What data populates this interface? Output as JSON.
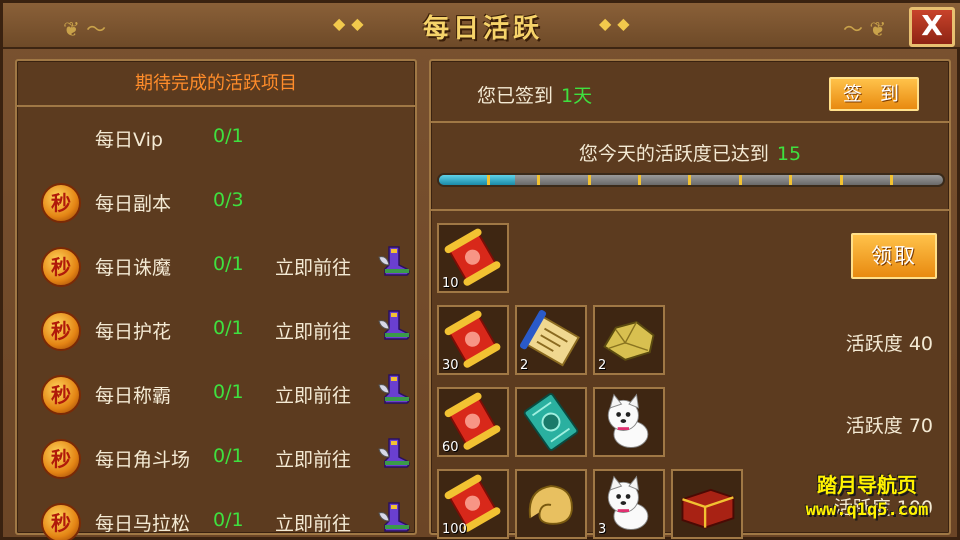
{
  "window": {
    "title": "每日活跃",
    "close_label": "X"
  },
  "left": {
    "header": "期待完成的活跃项目",
    "badge_text": "秒",
    "tasks": [
      {
        "name": "每日Vip",
        "progress": "0/1",
        "badge": false,
        "go": ""
      },
      {
        "name": "每日副本",
        "progress": "0/3",
        "badge": true,
        "go": ""
      },
      {
        "name": "每日诛魔",
        "progress": "0/1",
        "badge": true,
        "go": "立即前往"
      },
      {
        "name": "每日护花",
        "progress": "0/1",
        "badge": true,
        "go": "立即前往"
      },
      {
        "name": "每日称霸",
        "progress": "0/1",
        "badge": true,
        "go": "立即前往"
      },
      {
        "name": "每日角斗场",
        "progress": "0/1",
        "badge": true,
        "go": "立即前往"
      },
      {
        "name": "每日马拉松",
        "progress": "0/1",
        "badge": true,
        "go": "立即前往"
      }
    ]
  },
  "right": {
    "sign": {
      "prefix": "您已签到",
      "days": "1天",
      "button": "签 到"
    },
    "activity": {
      "prefix": "您今天的活跃度已达到",
      "value": "15",
      "fill_fraction": 0.15,
      "ticks": 10
    },
    "claim_button": "领取",
    "rewards": [
      {
        "requirement": "",
        "items": [
          {
            "icon": "red-scroll",
            "count": "10"
          }
        ]
      },
      {
        "requirement": "活跃度 40",
        "items": [
          {
            "icon": "red-scroll",
            "count": "30"
          },
          {
            "icon": "blue-scroll",
            "count": "2"
          },
          {
            "icon": "gold-ore",
            "count": "2"
          }
        ]
      },
      {
        "requirement": "活跃度 70",
        "items": [
          {
            "icon": "red-scroll",
            "count": "60"
          },
          {
            "icon": "green-scroll",
            "count": ""
          },
          {
            "icon": "white-puppy",
            "count": ""
          }
        ]
      },
      {
        "requirement": "活跃度 100",
        "items": [
          {
            "icon": "red-scroll",
            "count": "100"
          },
          {
            "icon": "gold-shell",
            "count": ""
          },
          {
            "icon": "white-puppy",
            "count": "3"
          },
          {
            "icon": "red-chest",
            "count": ""
          }
        ]
      }
    ]
  },
  "watermark": {
    "line1": "踏月导航页",
    "line2": "www.q1q5.com"
  }
}
